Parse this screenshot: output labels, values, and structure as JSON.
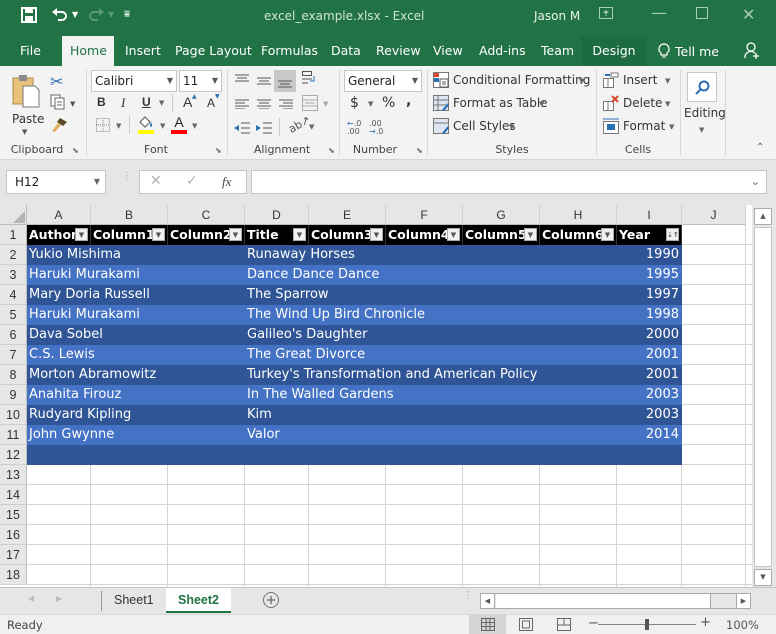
{
  "app": {
    "file_title": "excel_example.xlsx  -  Excel",
    "user": "Jason M"
  },
  "quick_access": {
    "save_icon": "save-icon",
    "undo_icon": "undo-icon",
    "redo_icon": "redo-icon",
    "customize_icon": "customize-toolbar-icon"
  },
  "tabs": [
    {
      "label": "File"
    },
    {
      "label": "Home"
    },
    {
      "label": "Insert"
    },
    {
      "label": "Page Layout"
    },
    {
      "label": "Formulas"
    },
    {
      "label": "Data"
    },
    {
      "label": "Review"
    },
    {
      "label": "View"
    },
    {
      "label": "Add-ins"
    },
    {
      "label": "Team"
    },
    {
      "label": "Design"
    }
  ],
  "tell_me": "Tell me",
  "ribbon": {
    "clipboard": {
      "paste": "Paste",
      "label": "Clipboard"
    },
    "font": {
      "name": "Calibri",
      "size": "11",
      "bold": "B",
      "italic": "I",
      "underline": "U",
      "grow": "A",
      "shrink": "A",
      "font_color": "A",
      "label": "Font",
      "fill_color": "#ffff00",
      "text_color": "#ff0000"
    },
    "alignment": {
      "label": "Alignment"
    },
    "number": {
      "format": "General",
      "currency": "$",
      "percent": "%",
      "comma": ",",
      "label": "Number"
    },
    "styles": {
      "conditional": "Conditional Formatting",
      "format_table": "Format as Table",
      "cell_styles": "Cell Styles",
      "label": "Styles"
    },
    "cells": {
      "insert": "Insert",
      "delete": "Delete",
      "format": "Format",
      "label": "Cells"
    },
    "editing": {
      "label": "Editing"
    }
  },
  "formula_bar": {
    "name_box": "H12",
    "fx": "fx",
    "formula": ""
  },
  "columns": [
    "A",
    "B",
    "C",
    "D",
    "E",
    "F",
    "G",
    "H",
    "I",
    "J"
  ],
  "table": {
    "headers": [
      "Author",
      "Column1",
      "Column2",
      "Title",
      "Column3",
      "Column4",
      "Column5",
      "Column6",
      "Year"
    ],
    "rows": [
      {
        "author": "Yukio Mishima",
        "title": "Runaway Horses",
        "year": "1990"
      },
      {
        "author": "Haruki Murakami",
        "title": "Dance Dance Dance",
        "year": "1995"
      },
      {
        "author": "Mary Doria Russell",
        "title": "The Sparrow",
        "year": "1997"
      },
      {
        "author": "Haruki Murakami",
        "title": "The Wind Up Bird Chronicle",
        "year": "1998"
      },
      {
        "author": "Dava Sobel",
        "title": "Galileo's Daughter",
        "year": "2000"
      },
      {
        "author": "C.S. Lewis",
        "title": "The Great Divorce",
        "year": "2001"
      },
      {
        "author": "Morton Abramowitz",
        "title": "Turkey's Transformation and American Policy",
        "year": "2001"
      },
      {
        "author": "Anahita Firouz",
        "title": "In The Walled Gardens",
        "year": "2003"
      },
      {
        "author": "Rudyard Kipling",
        "title": "Kim",
        "year": "2003"
      },
      {
        "author": "John Gwynne",
        "title": "Valor",
        "year": "2014"
      }
    ],
    "band_dark": "#2f5597",
    "band_light": "#4472c4"
  },
  "row_numbers": [
    "1",
    "2",
    "3",
    "4",
    "5",
    "6",
    "7",
    "8",
    "9",
    "10",
    "11",
    "12",
    "13",
    "14",
    "15",
    "16",
    "17",
    "18"
  ],
  "sheets": [
    {
      "label": "Sheet1",
      "active": false
    },
    {
      "label": "Sheet2",
      "active": true
    }
  ],
  "status": {
    "ready": "Ready",
    "zoom": "100%"
  },
  "colors": {
    "brand": "#217346"
  }
}
